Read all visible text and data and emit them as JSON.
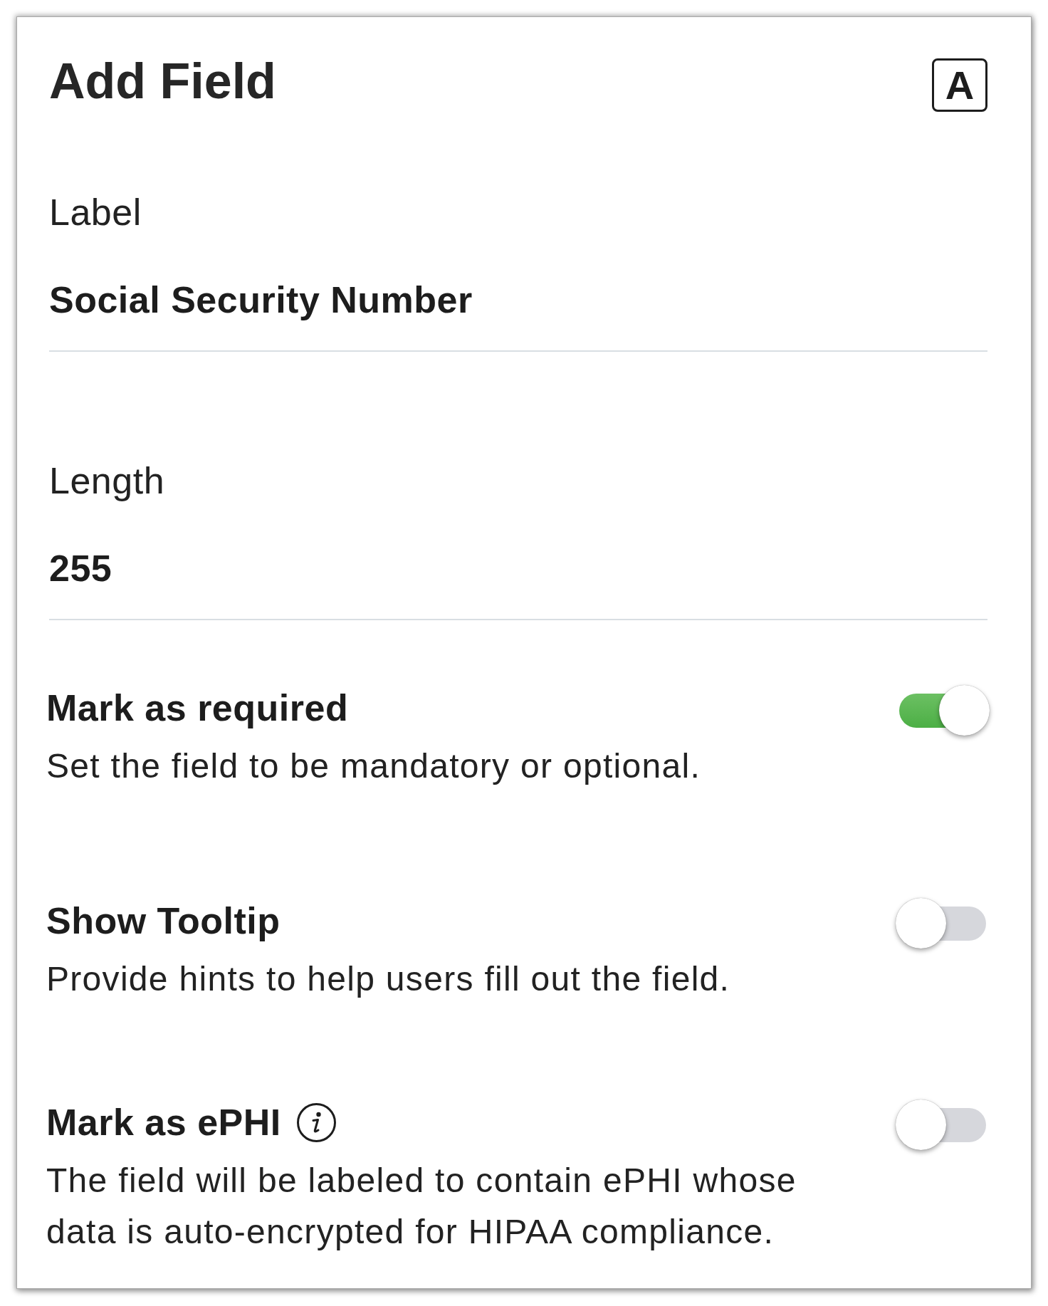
{
  "panel": {
    "title": "Add Field",
    "type_icon": "A"
  },
  "fields": [
    {
      "label": "Label",
      "value": "Social Security Number"
    },
    {
      "label": "Length",
      "value": "255"
    }
  ],
  "settings": [
    {
      "title": "Mark as required",
      "description": "Set the field to be mandatory or optional.",
      "on": true
    },
    {
      "title": "Show Tooltip",
      "description": "Provide hints to help users fill out the field.",
      "on": false
    },
    {
      "title": "Mark as ePHI",
      "description": "The field will be labeled to contain ePHI whose data is auto-encrypted for HIPAA compliance.",
      "on": false,
      "info_icon": true
    }
  ]
}
